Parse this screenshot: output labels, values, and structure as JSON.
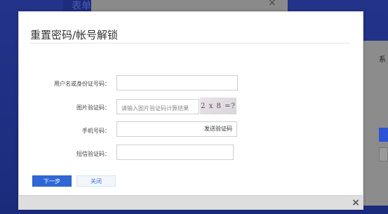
{
  "background": {
    "title": "表单",
    "side_label": "系"
  },
  "dialog": {
    "title": "重置密码/帐号解锁",
    "fields": {
      "username_label": "用户名或身份证号码：",
      "captcha_label": "图片验证码：",
      "captcha_placeholder": "请输入图片验证码计算结果",
      "captcha_text": "2 x 8 =?",
      "phone_label": "手机号码：",
      "send_code_label": "发送验证码",
      "sms_label": "短信验证码："
    },
    "buttons": {
      "next": "下一步",
      "close": "关闭"
    },
    "footer_close": "×"
  }
}
